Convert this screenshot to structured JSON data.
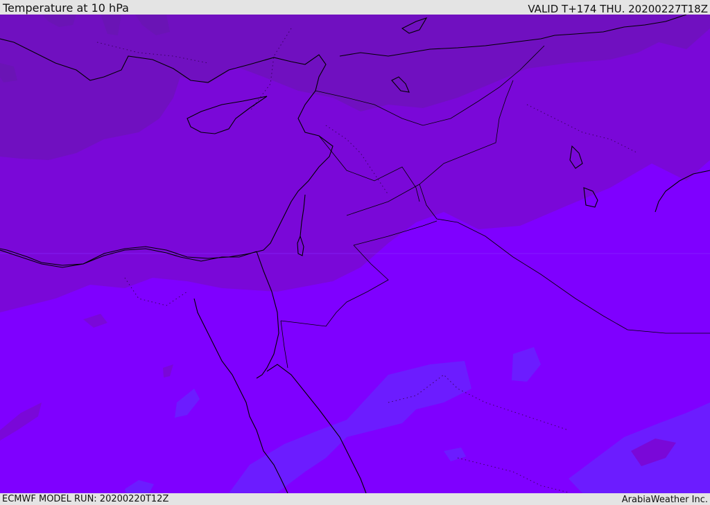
{
  "header": {
    "title": "Temperature at 10 hPa",
    "valid": "VALID T+174 THU. 20200227T18Z"
  },
  "footer": {
    "model_run": "ECMWF MODEL RUN: 20200220T12Z",
    "credit": "ArabiaWeather Inc."
  },
  "map": {
    "colors": {
      "band_darkest": "#6a14b5",
      "band_dark": "#7010c0",
      "band_mid": "#7a08d8",
      "band_main": "#7f00ff",
      "band_cool": "#6c1cff",
      "coastline": "#000000"
    }
  }
}
